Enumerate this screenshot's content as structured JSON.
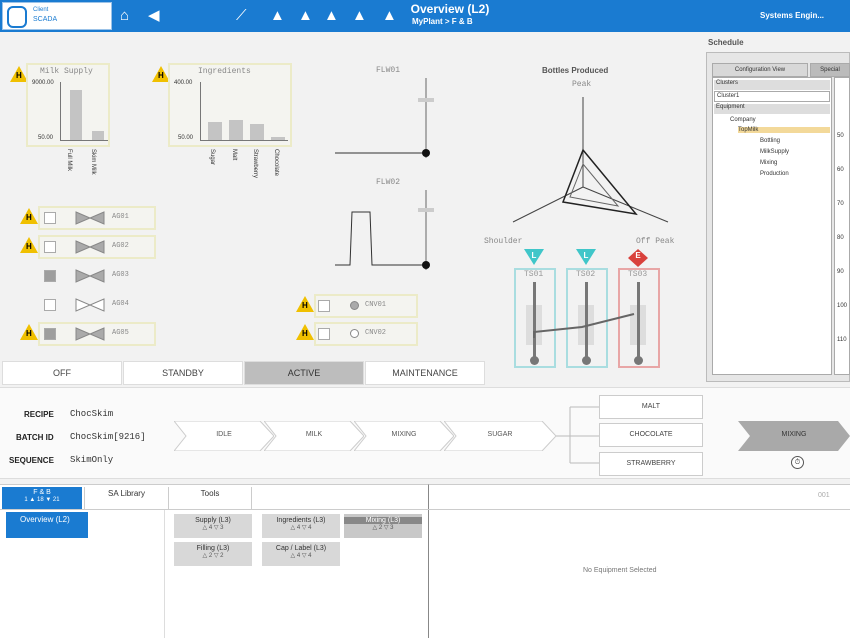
{
  "app": {
    "logo_line1": "Client",
    "logo_line2": "SCADA",
    "title": "Overview (L2)",
    "breadcrumb": "MyPlant > F & B",
    "user": "Systems Engin...",
    "accent": "#1a7bd1"
  },
  "milk_supply": {
    "title": "Milk Supply",
    "ymax": "9000.00",
    "ymin": "50.00",
    "categories": [
      "Full Milk",
      "Skim Milk"
    ],
    "values": [
      8000,
      1500
    ],
    "alarm": "H"
  },
  "ingredients": {
    "title": "Ingredients",
    "ymax": "400.00",
    "ymin": "50.00",
    "categories": [
      "Sugar",
      "Malt",
      "Strawberry",
      "Chocolate"
    ],
    "values": [
      160,
      175,
      150,
      70
    ],
    "alarm": "H"
  },
  "flows": {
    "flw01": "FLW01",
    "flw02": "FLW02"
  },
  "bottles": {
    "title": "Bottles Produced",
    "peak": "Peak",
    "shoulder": "Shoulder",
    "offpeak": "Off Peak"
  },
  "agitators": [
    {
      "label": "AG01",
      "alarm": "H"
    },
    {
      "label": "AG02",
      "alarm": "H"
    },
    {
      "label": "AG03",
      "alarm": ""
    },
    {
      "label": "AG04",
      "alarm": ""
    },
    {
      "label": "AG05",
      "alarm": "H"
    }
  ],
  "conveyors": [
    {
      "label": "CNV01",
      "alarm": "H"
    },
    {
      "label": "CNV02",
      "alarm": "H"
    }
  ],
  "tanks": [
    {
      "label": "TS01",
      "badge": "L",
      "badge_color": "#3fc6c9"
    },
    {
      "label": "TS02",
      "badge": "L",
      "badge_color": "#3fc6c9"
    },
    {
      "label": "TS03",
      "badge": "E",
      "badge_color": "#d9413c"
    }
  ],
  "modes": [
    "OFF",
    "STANDBY",
    "ACTIVE",
    "MAINTENANCE"
  ],
  "batch": {
    "recipe_label": "RECIPE",
    "recipe_value": "ChocSkim",
    "batch_label": "BATCH ID",
    "batch_value": "ChocSkim[9216]",
    "sequence_label": "SEQUENCE",
    "sequence_value": "SkimOnly",
    "steps": [
      "IDLE",
      "MILK",
      "MIXING",
      "SUGAR"
    ],
    "options": [
      "MALT",
      "CHOCOLATE",
      "STRAWBERRY"
    ],
    "final": "MIXING"
  },
  "schedule": {
    "title": "Schedule",
    "tab1": "Configuration View",
    "tab2": "Special",
    "clusters_label": "Clusters",
    "cluster_value": "Cluster1",
    "equipment_label": "Equipment",
    "tree": [
      "Company",
      "TopMilk",
      "Bottling",
      "MilkSupply",
      "Mixing",
      "Production"
    ],
    "axis": [
      "50",
      "60",
      "70",
      "80",
      "90",
      "100",
      "110"
    ]
  },
  "bottom": {
    "nav_title": "F & B",
    "nav_stats": "1   ▲ 18   ▼ 21",
    "nav_item": "Overview (L2)",
    "tab_library": "SA Library",
    "tab_tools": "Tools",
    "tiles": [
      {
        "name": "Supply (L3)",
        "counts": "△ 4  ▽ 3"
      },
      {
        "name": "Ingredients (L3)",
        "counts": "△ 4  ▽ 4"
      },
      {
        "name": "Mixing (L3)",
        "counts": "△ 2  ▽ 3"
      },
      {
        "name": "Filling (L3)",
        "counts": "△ 2  ▽ 2"
      },
      {
        "name": "Cap / Label (L3)",
        "counts": "△ 4  ▽ 4"
      }
    ],
    "right_tab": "001",
    "no_equipment": "No Equipment Selected"
  }
}
